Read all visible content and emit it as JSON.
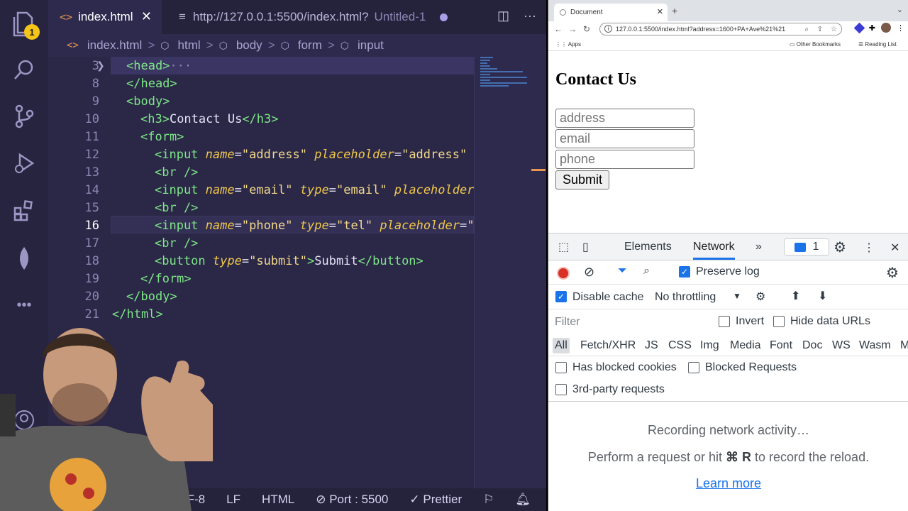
{
  "vscode": {
    "activity": {
      "badge": "1"
    },
    "tabs": [
      {
        "icon": "<>",
        "label": "index.html",
        "close": "✕"
      },
      {
        "label": "http://127.0.0.1:5500/index.html?",
        "sublabel": "Untitled-1"
      }
    ],
    "breadcrumb": [
      "index.html",
      "html",
      "body",
      "form",
      "input"
    ],
    "lines": [
      {
        "n": "3"
      },
      {
        "n": "8"
      },
      {
        "n": "9"
      },
      {
        "n": "10"
      },
      {
        "n": "11"
      },
      {
        "n": "12"
      },
      {
        "n": "13"
      },
      {
        "n": "14"
      },
      {
        "n": "15"
      },
      {
        "n": "16"
      },
      {
        "n": "17"
      },
      {
        "n": "18"
      },
      {
        "n": "19"
      },
      {
        "n": "20"
      },
      {
        "n": "21"
      }
    ],
    "code": {
      "l3": "<head>",
      "l3_ellipsis": "···",
      "l8": "</head>",
      "l9": "<body>",
      "l10_open": "<h3>",
      "l10_text": "Contact Us",
      "l10_close": "</h3>",
      "l11": "<form>",
      "l12_tag": "<input ",
      "l12_a1": "name",
      "l12_v1": "\"address\"",
      "l12_a2": "placeholder",
      "l12_v2": "\"address\"",
      "l12_end": " /:",
      "l13": "<br />",
      "l14_tag": "<input ",
      "l14_a1": "name",
      "l14_v1": "\"email\"",
      "l14_a2": "type",
      "l14_v2": "\"email\"",
      "l14_a3": "placeholder",
      "l14_v3": "\"",
      "l15": "<br />",
      "l16_tag": "<input ",
      "l16_a1": "name",
      "l16_v1": "\"phone\"",
      "l16_a2": "type",
      "l16_v2": "\"tel\"",
      "l16_a3": "placeholder",
      "l16_v3": "\"pl",
      "l17": "<br />",
      "l18_tag": "<button ",
      "l18_a1": "type",
      "l18_v1": "\"submit\"",
      "l18_gt": ">",
      "l18_text": "Submit",
      "l18_close": "</button>",
      "l19": "</form>",
      "l20": "</body>",
      "l21": "</html>"
    },
    "status": {
      "encoding": "TF-8",
      "eol": "LF",
      "language": "HTML",
      "port": "Port : 5500",
      "prettier": "Prettier"
    }
  },
  "browser": {
    "tab_title": "Document",
    "url": "127.0.0.1:5500/index.html?address=1600+PA+Ave%21%21",
    "bookmarks": {
      "apps": "Apps",
      "other": "Other Bookmarks",
      "reading": "Reading List"
    },
    "page": {
      "title": "Contact Us",
      "address_placeholder": "address",
      "email_placeholder": "email",
      "phone_placeholder": "phone",
      "submit": "Submit"
    },
    "devtools": {
      "tabs": {
        "elements": "Elements",
        "network": "Network",
        "more": "»",
        "issues": "1"
      },
      "preserve_log": "Preserve log",
      "disable_cache": "Disable cache",
      "throttling": "No throttling",
      "filter_placeholder": "Filter",
      "invert": "Invert",
      "hide_data_urls": "Hide data URLs",
      "types": [
        "All",
        "Fetch/XHR",
        "JS",
        "CSS",
        "Img",
        "Media",
        "Font",
        "Doc",
        "WS",
        "Wasm",
        "M"
      ],
      "has_blocked_cookies": "Has blocked cookies",
      "blocked_requests": "Blocked Requests",
      "third_party": "3rd-party requests",
      "empty_line1": "Recording network activity…",
      "empty_line2_a": "Perform a request or hit ",
      "empty_line2_key": "⌘ R",
      "empty_line2_b": " to record the reload.",
      "learn_more": "Learn more"
    }
  },
  "colors": {
    "vscode_bg": "#2a2747",
    "accent_blue": "#1a73e8",
    "record_red": "#d93025"
  }
}
